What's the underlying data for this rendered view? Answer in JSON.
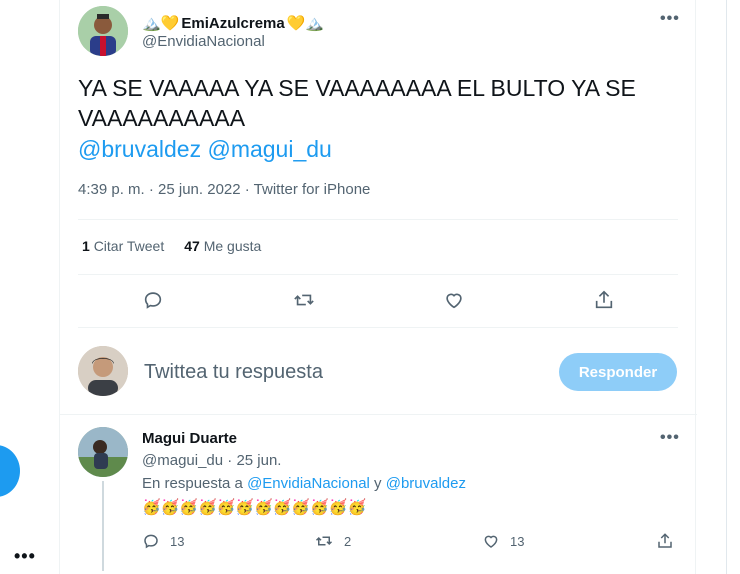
{
  "tweet": {
    "display_name": "EmiAzulcrema",
    "name_emojis_before": "🏔️💛",
    "name_emojis_after": "💛🏔️",
    "handle": "@EnvidiaNacional",
    "text": "YA SE VAAAAA YA SE VAAAAAAAA EL BULTO YA SE VAAAAAAAAAA",
    "mentions": "@bruvaldez @magui_du",
    "meta": "4:39 p. m. · 25 jun. 2022 · Twitter for iPhone",
    "quote_count": "1",
    "quote_label": "Citar Tweet",
    "like_count": "47",
    "like_label": "Me gusta"
  },
  "compose": {
    "placeholder": "Twittea tu respuesta",
    "button_label": "Responder"
  },
  "reply": {
    "display_name": "Magui Duarte",
    "handle_date": "@magui_du · 25 jun.",
    "in_reply_prefix": "En respuesta a",
    "in_reply_user1": "@EnvidiaNacional",
    "in_reply_joiner": "y",
    "in_reply_user2": "@bruvaldez",
    "emojis": "🥳🥳🥳🥳🥳🥳🥳🥳🥳🥳🥳🥳",
    "reply_count": "13",
    "retweet_count": "2",
    "like_count": "13"
  },
  "colors": {
    "accent": "#1d9bf0",
    "button_disabled": "#8ecdf8",
    "secondary_text": "#536471"
  }
}
